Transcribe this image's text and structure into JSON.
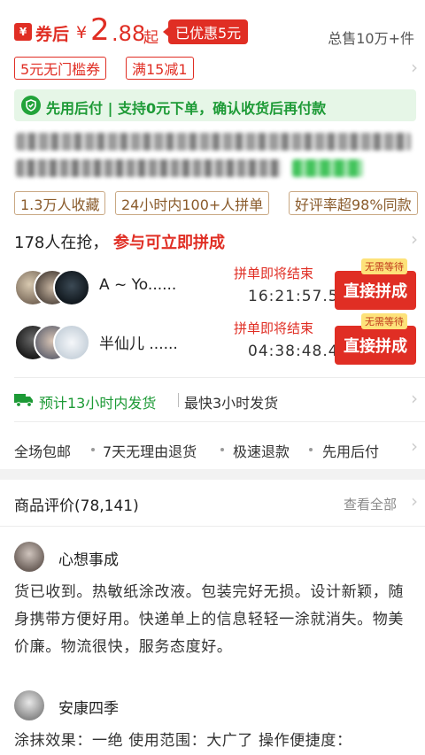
{
  "price": {
    "yuan_icon": "¥",
    "after_coupon_label": "券后",
    "currency": "¥",
    "integer": "2",
    "decimal": ".88",
    "suffix": "起",
    "discount_badge": "已优惠5元",
    "total_sold": "总售10万+件"
  },
  "coupons": [
    "5元无门槛券",
    "满15减1"
  ],
  "pay_later": {
    "icon": "pay-later-shield-icon",
    "text": "先用后付 | 支持0元下单，确认收货后再付款"
  },
  "tags": [
    "1.3万人收藏",
    "24小时内100+人拼单",
    "好评率超98%同款"
  ],
  "group_buy": {
    "grabbing": "178人在抢，",
    "cta": "参与可立即拼成",
    "groups": [
      {
        "name": "A ~ Yo......",
        "status": "拼单即将结束",
        "countdown": "16:21:57.5",
        "badge": "无需等待",
        "button": "直接拼成"
      },
      {
        "name": "半仙儿 ......",
        "status": "拼单即将结束",
        "countdown": "04:38:48.4",
        "badge": "无需等待",
        "button": "直接拼成"
      }
    ]
  },
  "shipping": {
    "eta": "预计13小时内发货",
    "fastest": "最快3小时发货"
  },
  "services": [
    "全场包邮",
    "7天无理由退货",
    "极速退款",
    "先用后付"
  ],
  "reviews": {
    "title": "商品评价(78,141)",
    "view_all": "查看全部",
    "items": [
      {
        "user": "心想事成",
        "text": "货已收到。热敏纸涂改液。包装完好无损。设计新颖，随身携带方便好用。快递单上的信息轻轻一涂就消失。物美价廉。物流很快，服务态度好。"
      },
      {
        "user": "安康四季",
        "text": "涂抹效果：一绝 使用范围：大广了 操作便捷度："
      }
    ]
  },
  "colors": {
    "brand_red": "#e02e24",
    "green": "#1d9a36",
    "tag_brown": "#8a5b2b"
  }
}
